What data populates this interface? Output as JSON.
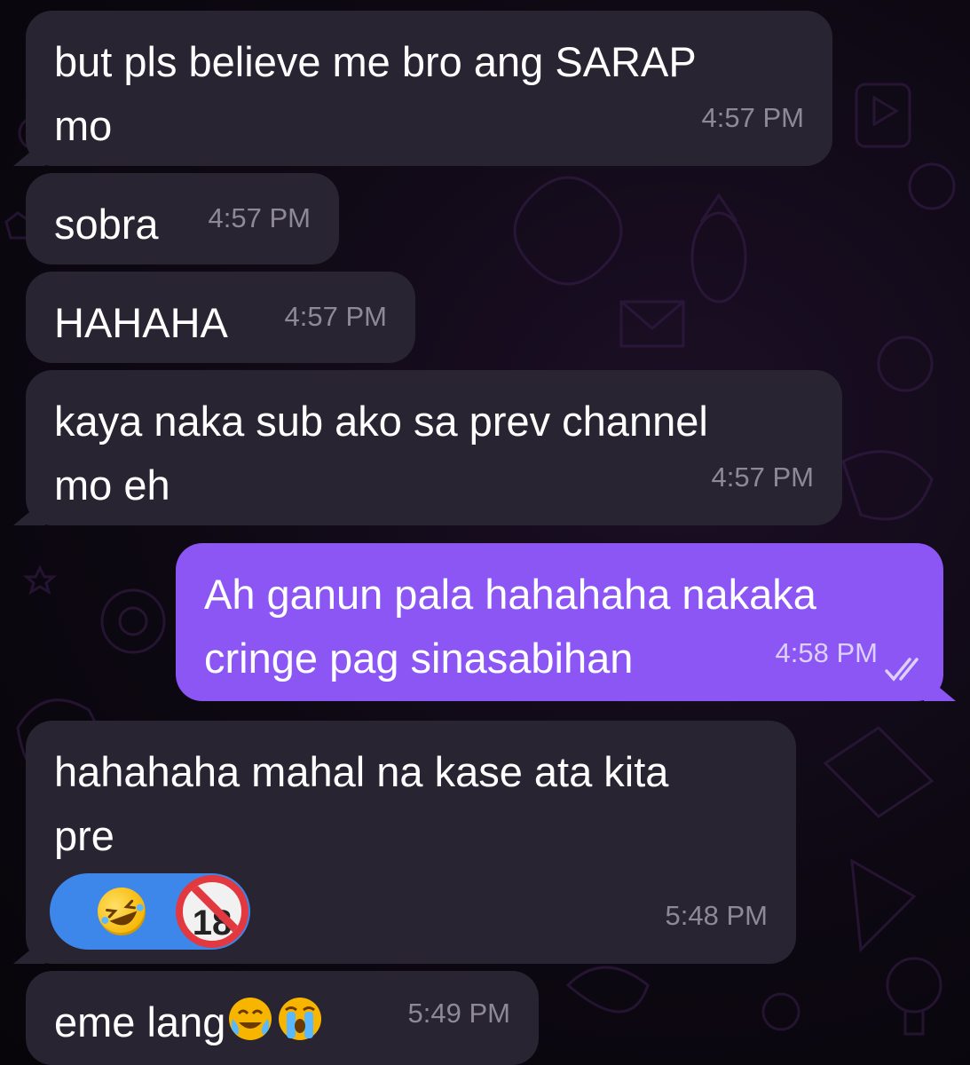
{
  "colors": {
    "incoming_bubble": "#282431",
    "outgoing_bubble": "#8b56f3",
    "reaction_pill": "#3d86ea",
    "timestamp_incoming": "#8e8996",
    "timestamp_outgoing": "#ddd0fb"
  },
  "messages": [
    {
      "direction": "incoming",
      "text": "but pls believe me bro ang SARAP\nmo",
      "time": "4:57 PM"
    },
    {
      "direction": "incoming",
      "text": "sobra",
      "time": "4:57 PM"
    },
    {
      "direction": "incoming",
      "text": "HAHAHA",
      "time": "4:57 PM"
    },
    {
      "direction": "incoming",
      "text": "kaya naka sub ako sa prev channel\nmo eh",
      "time": "4:57 PM"
    },
    {
      "direction": "outgoing",
      "text": "Ah ganun pala hahahaha nakaka\ncringe pag sinasabihan",
      "time": "4:58 PM",
      "status_icon": "double-check-read-icon"
    },
    {
      "direction": "incoming",
      "text": "hahahaha mahal na kase ata kita\npre",
      "time": "5:48 PM",
      "reactions": [
        {
          "icon": "rolling-laughing-emoji-icon"
        },
        {
          "icon": "no-under-18-emoji-icon",
          "label": "18"
        }
      ]
    },
    {
      "direction": "incoming",
      "text": "eme lang",
      "time": "5:49 PM",
      "trailing_emojis": [
        "tears-of-joy-emoji-icon",
        "loudly-crying-emoji-icon"
      ]
    }
  ]
}
